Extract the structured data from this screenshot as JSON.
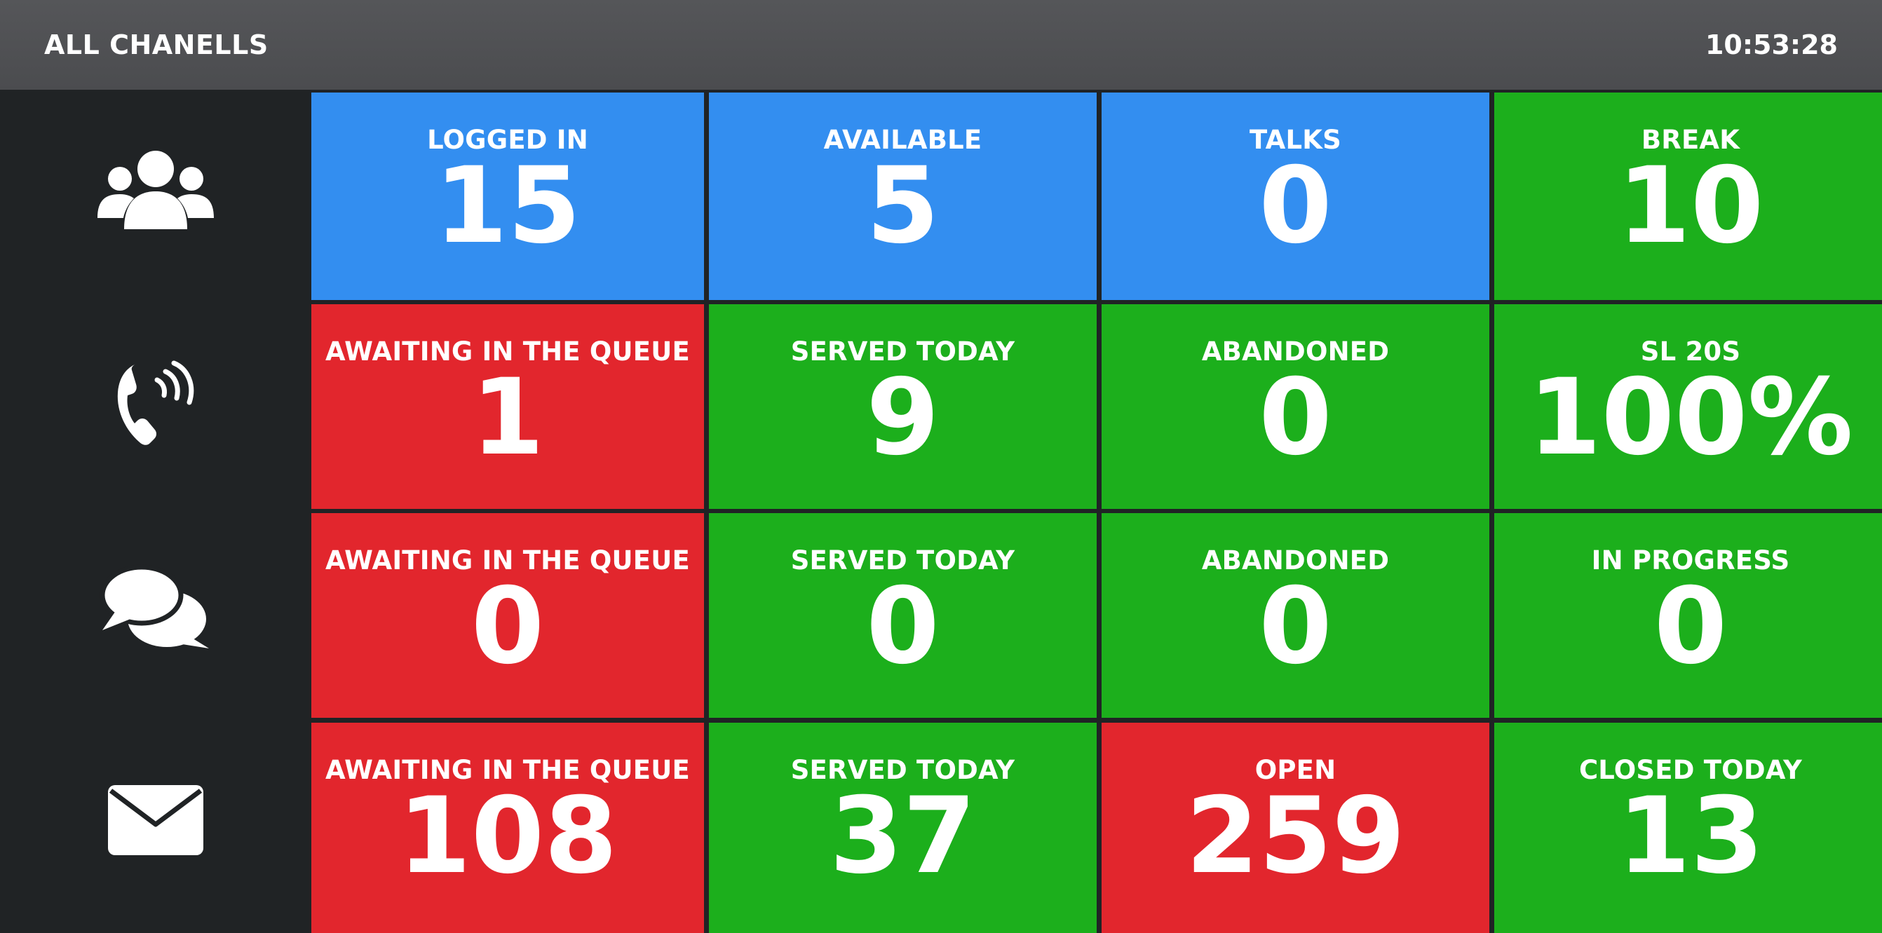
{
  "header": {
    "title": "ALL CHANELLS",
    "clock": "10:53:28"
  },
  "colors": {
    "blue": "#338ef0",
    "green": "#1caf1c",
    "red": "#e2262d"
  },
  "sidebar": {
    "icons": [
      "users-icon",
      "phone-icon",
      "chat-icon",
      "mail-icon"
    ]
  },
  "tiles": [
    [
      {
        "label": "LOGGED IN",
        "value": "15",
        "color": "blue"
      },
      {
        "label": "AVAILABLE",
        "value": "5",
        "color": "blue"
      },
      {
        "label": "TALKS",
        "value": "0",
        "color": "blue"
      },
      {
        "label": "BREAK",
        "value": "10",
        "color": "green"
      }
    ],
    [
      {
        "label": "AWAITING IN THE QUEUE",
        "value": "1",
        "color": "red"
      },
      {
        "label": "SERVED TODAY",
        "value": "9",
        "color": "green"
      },
      {
        "label": "ABANDONED",
        "value": "0",
        "color": "green"
      },
      {
        "label": "SL 20S",
        "value": "100%",
        "color": "green"
      }
    ],
    [
      {
        "label": "AWAITING IN THE QUEUE",
        "value": "0",
        "color": "red"
      },
      {
        "label": "SERVED TODAY",
        "value": "0",
        "color": "green"
      },
      {
        "label": "ABANDONED",
        "value": "0",
        "color": "green"
      },
      {
        "label": "IN PROGRESS",
        "value": "0",
        "color": "green"
      }
    ],
    [
      {
        "label": "AWAITING IN THE QUEUE",
        "value": "108",
        "color": "red"
      },
      {
        "label": "SERVED TODAY",
        "value": "37",
        "color": "green"
      },
      {
        "label": "OPEN",
        "value": "259",
        "color": "red"
      },
      {
        "label": "CLOSED TODAY",
        "value": "13",
        "color": "green"
      }
    ]
  ]
}
